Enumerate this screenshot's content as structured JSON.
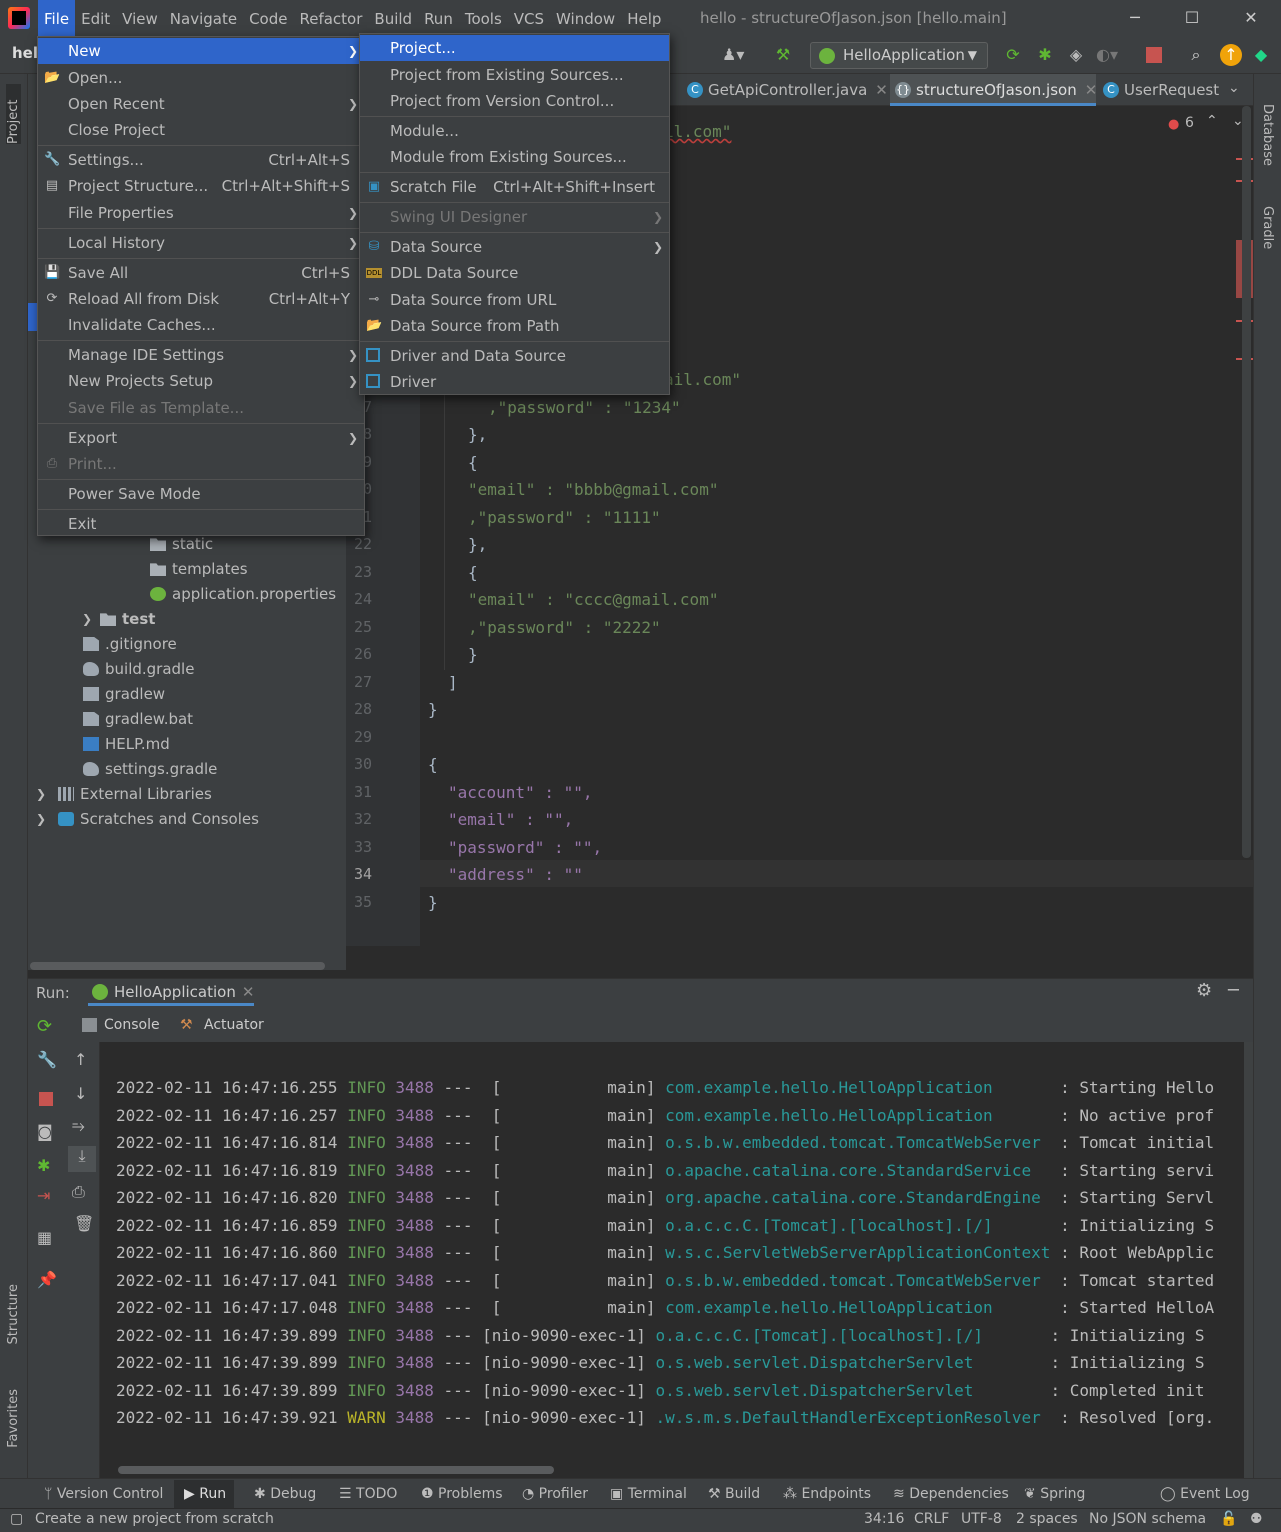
{
  "window": {
    "title": "hello - structureOfJason.json [hello.main]",
    "project_crumb": "hel"
  },
  "menubar": [
    "File",
    "Edit",
    "View",
    "Navigate",
    "Code",
    "Refactor",
    "Build",
    "Run",
    "Tools",
    "VCS",
    "Window",
    "Help"
  ],
  "toolbar": {
    "run_config": "HelloApplication"
  },
  "tabs": [
    "GetApiController.java",
    "structureOfJason.json",
    "UserRequest.j"
  ],
  "editor": {
    "error_count": "6"
  },
  "file_menu": {
    "new": "New",
    "open": "Open...",
    "open_recent": "Open Recent",
    "close_project": "Close Project",
    "settings": "Settings...",
    "settings_sc": "Ctrl+Alt+S",
    "project_structure": "Project Structure...",
    "project_structure_sc": "Ctrl+Alt+Shift+S",
    "file_properties": "File Properties",
    "local_history": "Local History",
    "save_all": "Save All",
    "save_all_sc": "Ctrl+S",
    "reload": "Reload All from Disk",
    "reload_sc": "Ctrl+Alt+Y",
    "invalidate": "Invalidate Caches...",
    "manage_ide": "Manage IDE Settings",
    "new_projects_setup": "New Projects Setup",
    "save_template": "Save File as Template...",
    "export": "Export",
    "print": "Print...",
    "power_save": "Power Save Mode",
    "exit": "Exit"
  },
  "new_menu": {
    "project": "Project...",
    "from_existing": "Project from Existing Sources...",
    "from_vcs": "Project from Version Control...",
    "module": "Module...",
    "module_existing": "Module from Existing Sources...",
    "scratch": "Scratch File",
    "scratch_sc": "Ctrl+Alt+Shift+Insert",
    "swing": "Swing UI Designer",
    "data_source": "Data Source",
    "ddl": "DDL Data Source",
    "ds_url": "Data Source from URL",
    "ds_path": "Data Source from Path",
    "driver_ds": "Driver and Data Source",
    "driver": "Driver"
  },
  "tree": {
    "static": "static",
    "templates": "templates",
    "app_props": "application.properties",
    "test": "test",
    "gitignore": ".gitignore",
    "build_gradle": "build.gradle",
    "gradlew": "gradlew",
    "gradlew_bat": "gradlew.bat",
    "help_md": "HELP.md",
    "settings_gradle": "settings.gradle",
    "ext_libs": "External Libraries",
    "scratches": "Scratches and Consoles"
  },
  "code": {
    "l_top": "il.com\"",
    "l6": "ail.com\"",
    "l7": ",\"password\" : \"1234\"",
    "l8": "},",
    "l9": "{",
    "l10": "\"email\" : \"bbbb@gmail.com\"",
    "l11": ",\"password\" : \"1111\"",
    "l22": "},",
    "l23": "{",
    "l24": "\"email\" : \"cccc@gmail.com\"",
    "l25": ",\"password\" : \"2222\"",
    "l26": "}",
    "l27": "]",
    "l28": "}",
    "l30": "{",
    "l31": "\"account\" : \"\",",
    "l32": "\"email\" : \"\",",
    "l33": "\"password\" : \"\",",
    "l34": "\"address\" : \"\"",
    "l35": "}"
  },
  "line_numbers": [
    "7",
    "8",
    "9",
    "0",
    "1",
    "22",
    "23",
    "24",
    "25",
    "26",
    "27",
    "28",
    "29",
    "30",
    "31",
    "32",
    "33",
    "34",
    "35"
  ],
  "run": {
    "label": "Run:",
    "config": "HelloApplication",
    "console_tab": "Console",
    "actuator_tab": "Actuator"
  },
  "log": [
    {
      "ts": "2022-02-11 16:47:16.255",
      "lvl": "INFO",
      "pid": "3488",
      "thread": "---  [           main]",
      "cls": "com.example.hello.HelloApplication      ",
      "msg": ": Starting Hello"
    },
    {
      "ts": "2022-02-11 16:47:16.257",
      "lvl": "INFO",
      "pid": "3488",
      "thread": "---  [           main]",
      "cls": "com.example.hello.HelloApplication      ",
      "msg": ": No active prof"
    },
    {
      "ts": "2022-02-11 16:47:16.814",
      "lvl": "INFO",
      "pid": "3488",
      "thread": "---  [           main]",
      "cls": "o.s.b.w.embedded.tomcat.TomcatWebServer ",
      "msg": ": Tomcat initial"
    },
    {
      "ts": "2022-02-11 16:47:16.819",
      "lvl": "INFO",
      "pid": "3488",
      "thread": "---  [           main]",
      "cls": "o.apache.catalina.core.StandardService  ",
      "msg": ": Starting servi"
    },
    {
      "ts": "2022-02-11 16:47:16.820",
      "lvl": "INFO",
      "pid": "3488",
      "thread": "---  [           main]",
      "cls": "org.apache.catalina.core.StandardEngine ",
      "msg": ": Starting Servl"
    },
    {
      "ts": "2022-02-11 16:47:16.859",
      "lvl": "INFO",
      "pid": "3488",
      "thread": "---  [           main]",
      "cls": "o.a.c.c.C.[Tomcat].[localhost].[/]      ",
      "msg": ": Initializing S"
    },
    {
      "ts": "2022-02-11 16:47:16.860",
      "lvl": "INFO",
      "pid": "3488",
      "thread": "---  [           main]",
      "cls": "w.s.c.ServletWebServerApplicationContext",
      "msg": ": Root WebApplic"
    },
    {
      "ts": "2022-02-11 16:47:17.041",
      "lvl": "INFO",
      "pid": "3488",
      "thread": "---  [           main]",
      "cls": "o.s.b.w.embedded.tomcat.TomcatWebServer ",
      "msg": ": Tomcat started"
    },
    {
      "ts": "2022-02-11 16:47:17.048",
      "lvl": "INFO",
      "pid": "3488",
      "thread": "---  [           main]",
      "cls": "com.example.hello.HelloApplication      ",
      "msg": ": Started HelloA"
    },
    {
      "ts": "2022-02-11 16:47:39.899",
      "lvl": "INFO",
      "pid": "3488",
      "thread": "--- [nio-9090-exec-1]",
      "cls": "o.a.c.c.C.[Tomcat].[localhost].[/]      ",
      "msg": ": Initializing S"
    },
    {
      "ts": "2022-02-11 16:47:39.899",
      "lvl": "INFO",
      "pid": "3488",
      "thread": "--- [nio-9090-exec-1]",
      "cls": "o.s.web.servlet.DispatcherServlet       ",
      "msg": ": Initializing S"
    },
    {
      "ts": "2022-02-11 16:47:39.899",
      "lvl": "INFO",
      "pid": "3488",
      "thread": "--- [nio-9090-exec-1]",
      "cls": "o.s.web.servlet.DispatcherServlet       ",
      "msg": ": Completed init"
    },
    {
      "ts": "2022-02-11 16:47:39.921",
      "lvl": "WARN",
      "pid": "3488",
      "thread": "--- [nio-9090-exec-1]",
      "cls": ".w.s.m.s.DefaultHandlerExceptionResolver ",
      "msg": ": Resolved [org."
    }
  ],
  "bottom_tools": [
    "Version Control",
    "Run",
    "Debug",
    "TODO",
    "Problems",
    "Profiler",
    "Terminal",
    "Build",
    "Endpoints",
    "Dependencies",
    "Spring",
    "Event Log"
  ],
  "status": {
    "message": "Create a new project from scratch",
    "position": "34:16",
    "line_sep": "CRLF",
    "encoding": "UTF-8",
    "indent": "2 spaces",
    "schema": "No JSON schema"
  },
  "side": {
    "project": "Project",
    "structure": "Structure",
    "favorites": "Favorites",
    "database": "Database",
    "gradle": "Gradle"
  }
}
